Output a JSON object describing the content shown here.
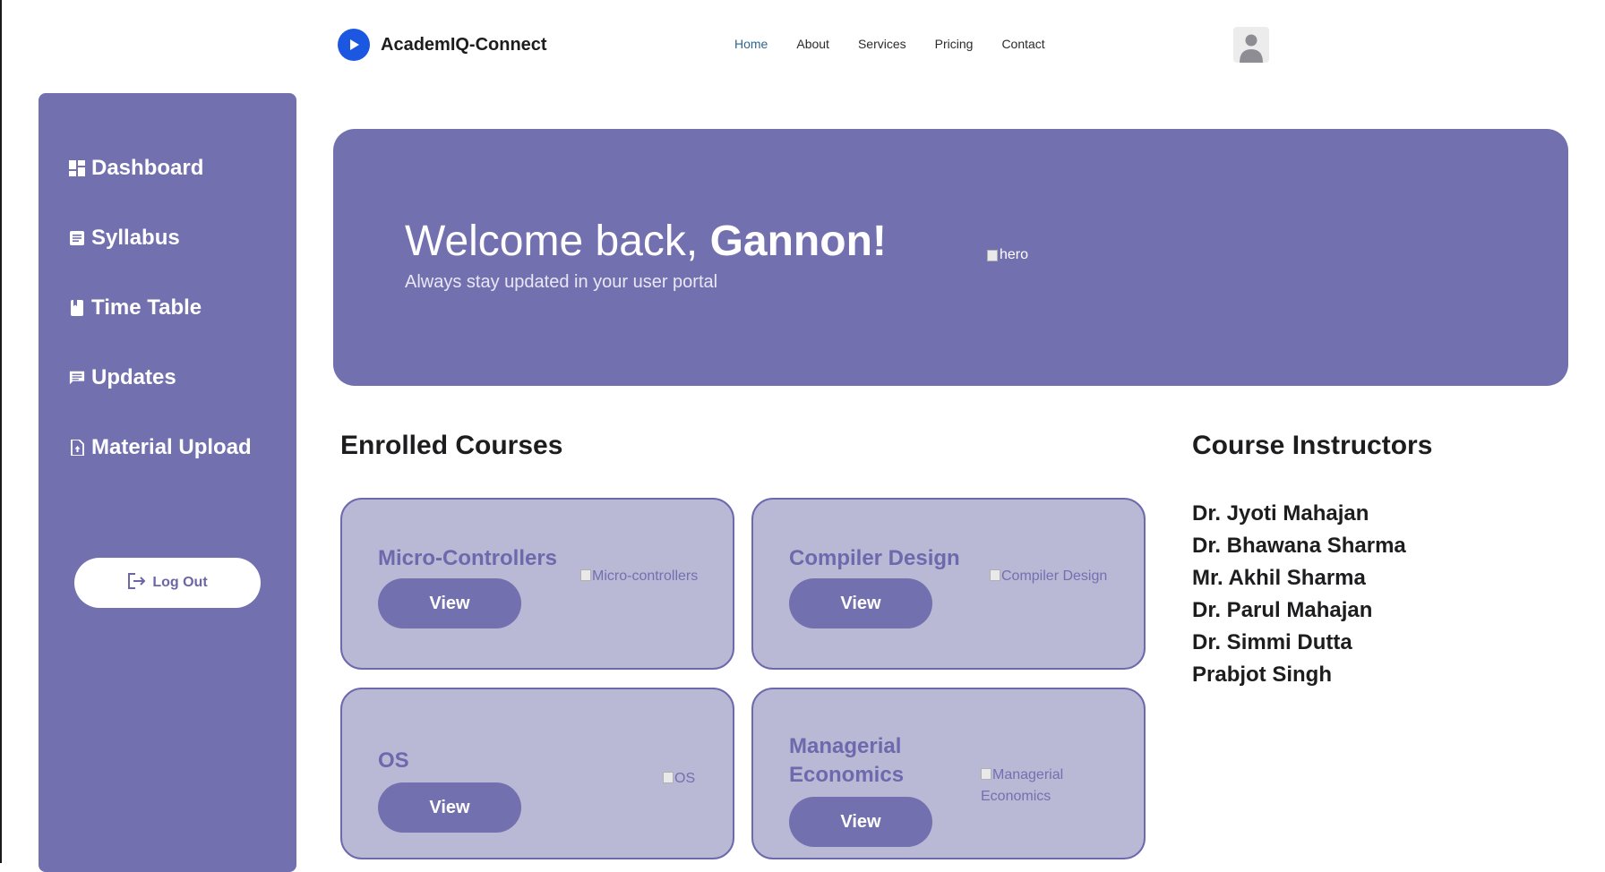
{
  "brand": {
    "name": "AcademIQ-Connect",
    "logo_icon": "play-circle-icon",
    "color": "#1b57e0"
  },
  "nav": {
    "items": [
      "Home",
      "About",
      "Services",
      "Pricing",
      "Contact"
    ],
    "active": "Home"
  },
  "sidebar": {
    "items": [
      {
        "label": "Dashboard",
        "icon": "dashboard-icon"
      },
      {
        "label": "Syllabus",
        "icon": "document-icon"
      },
      {
        "label": "Time Table",
        "icon": "book-icon"
      },
      {
        "label": "Updates",
        "icon": "chat-icon"
      },
      {
        "label": "Material Upload",
        "icon": "file-upload-icon"
      }
    ],
    "logout_label": "Log Out"
  },
  "hero": {
    "greeting": "Welcome back, ",
    "name": "Gannon!",
    "subtitle": "Always stay updated in your user portal",
    "image_alt": "hero"
  },
  "courses": {
    "title": "Enrolled Courses",
    "items": [
      {
        "title": "Micro-Controllers",
        "button": "View",
        "image_alt": "Micro-controllers"
      },
      {
        "title": "Compiler Design",
        "button": "View",
        "image_alt": "Compiler Design"
      },
      {
        "title": "OS",
        "button": "View",
        "image_alt": "OS"
      },
      {
        "title": "Managerial Economics",
        "button": "View",
        "image_alt": "Managerial Economics"
      }
    ]
  },
  "instructors": {
    "title": "Course Instructors",
    "items": [
      "Dr. Jyoti Mahajan",
      "Dr. Bhawana Sharma",
      "Mr. Akhil Sharma",
      "Dr. Parul Mahajan",
      "Dr. Simmi Dutta",
      "Prabjot Singh"
    ]
  },
  "colors": {
    "accent": "#7370b0",
    "card_bg": "#b9b8d5",
    "nav_active": "#2f6690"
  }
}
